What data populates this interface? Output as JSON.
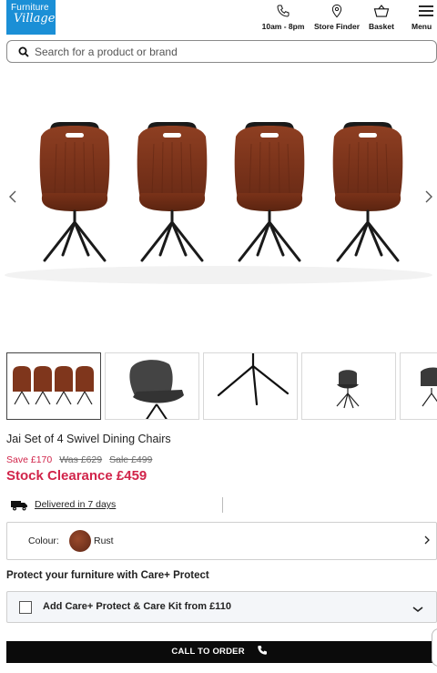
{
  "header": {
    "logo_line1": "Furniture",
    "logo_line2": "Village",
    "phone_label": "10am - 8pm",
    "store_finder_label": "Store Finder",
    "basket_label": "Basket",
    "menu_label": "Menu"
  },
  "search": {
    "placeholder": "Search for a product or brand",
    "value": ""
  },
  "gallery": {
    "prev_icon": "chevron-left-icon",
    "next_icon": "chevron-right-icon",
    "thumbnail_count": 5
  },
  "product": {
    "title": "Jai Set of 4 Swivel Dining Chairs",
    "save_text": "Save £170",
    "was_text": "Was £629",
    "sale_text": "Sale £499",
    "clearance_text": "Stock Clearance £459"
  },
  "delivery": {
    "text": "Delivered in 7 days"
  },
  "colour": {
    "label": "Colour:",
    "value": "Rust",
    "swatch_color": "#7a3520"
  },
  "protect": {
    "heading": "Protect your furniture with Care+ Protect",
    "option_label": "Add Care+ Protect & Care Kit from £110",
    "checked": false
  },
  "cta": {
    "label": "CALL TO ORDER"
  },
  "colors": {
    "brand_blue": "#1b8fd6",
    "price_red": "#d1244a",
    "cta_black": "#0b0b0b"
  }
}
